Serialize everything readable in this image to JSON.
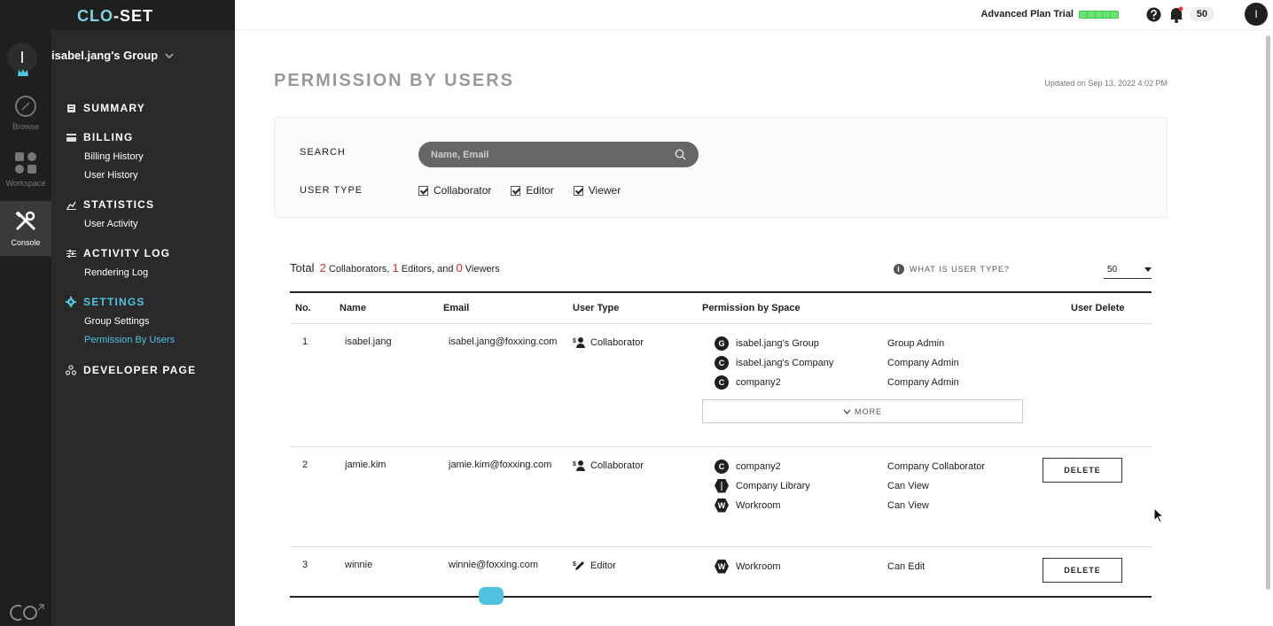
{
  "brand": {
    "logo_left": "CLO",
    "logo_dash": "-",
    "logo_right": "SET"
  },
  "rail": {
    "avatar_initial": "I",
    "items": [
      {
        "label": "Browse",
        "icon": "compass-icon"
      },
      {
        "label": "Workspace",
        "icon": "grid-icon"
      },
      {
        "label": "Console",
        "icon": "tools-icon",
        "active": true
      }
    ]
  },
  "sidebar": {
    "group_name": "isabel.jang's Group",
    "sections": [
      {
        "label": "SUMMARY",
        "subs": []
      },
      {
        "label": "BILLING",
        "subs": [
          "Billing History",
          "User History"
        ]
      },
      {
        "label": "STATISTICS",
        "subs": [
          "User Activity"
        ]
      },
      {
        "label": "ACTIVITY LOG",
        "subs": [
          "Rendering Log"
        ]
      },
      {
        "label": "SETTINGS",
        "subs": [
          "Group Settings",
          "Permission By Users"
        ],
        "active": true
      },
      {
        "label": "DEVELOPER PAGE",
        "subs": []
      }
    ]
  },
  "topbar": {
    "plan": "Advanced Plan Trial",
    "notification_count": "50",
    "user_initial": "I"
  },
  "page": {
    "title": "PERMISSION BY USERS",
    "updated": "Updated on Sep 13, 2022 4:02 PM"
  },
  "filters": {
    "search_label": "SEARCH",
    "search_placeholder": "Name, Email",
    "user_type_label": "USER TYPE",
    "types": [
      "Collaborator",
      "Editor",
      "Viewer"
    ]
  },
  "summary": {
    "total_label": "Total",
    "collaborators": "2",
    "collaborators_text": "Collaborators,",
    "editors": "1",
    "editors_text": "Editors, and",
    "viewers": "0",
    "viewers_text": "Viewers",
    "what_is": "WHAT IS USER TYPE?",
    "page_size": "50"
  },
  "table": {
    "headers": [
      "No.",
      "Name",
      "Email",
      "User Type",
      "Permission by Space",
      "User Delete"
    ],
    "more_label": "MORE",
    "delete_label": "DELETE",
    "rows": [
      {
        "no": "1",
        "name": "isabel.jang",
        "email": "isabel.jang@foxxing.com",
        "type": "Collaborator",
        "perms": [
          {
            "icon": "G",
            "space": "isabel.jang's Group",
            "role": "Group Admin"
          },
          {
            "icon": "C",
            "space": "isabel.jang's Company",
            "role": "Company Admin"
          },
          {
            "icon": "C",
            "space": "company2",
            "role": "Company Admin"
          }
        ]
      },
      {
        "no": "2",
        "name": "jamie.kim",
        "email": "jamie.kim@foxxing.com",
        "type": "Collaborator",
        "perms": [
          {
            "icon": "C",
            "space": "company2",
            "role": "Company Collaborator"
          },
          {
            "icon": "",
            "space": "Company Library",
            "role": "Can View"
          },
          {
            "icon": "W",
            "space": "Workroom",
            "role": "Can View"
          }
        ]
      },
      {
        "no": "3",
        "name": "winnie",
        "email": "winnie@foxxing.com",
        "type": "Editor",
        "perms": [
          {
            "icon": "W",
            "space": "Workroom",
            "role": "Can Edit"
          }
        ]
      }
    ]
  }
}
